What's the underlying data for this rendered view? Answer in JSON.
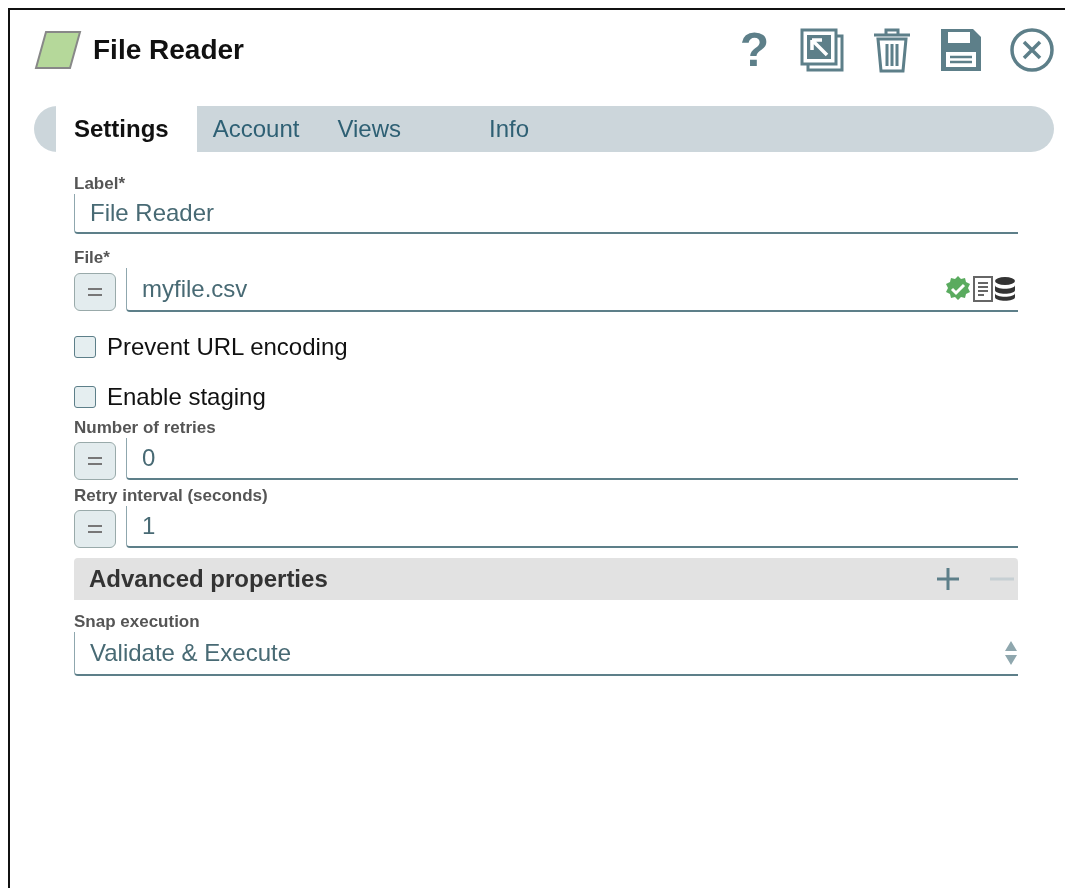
{
  "window": {
    "title": "File Reader",
    "help": "?"
  },
  "tabs": [
    {
      "label": "Settings",
      "selected": true
    },
    {
      "label": "Account",
      "selected": false
    },
    {
      "label": "Views",
      "selected": false
    },
    {
      "label": "Info",
      "selected": false
    }
  ],
  "fields": [
    {
      "kind": "text",
      "label": "Label*",
      "value": "File Reader"
    },
    {
      "kind": "file",
      "label": "File*",
      "value": "myfile.csv"
    },
    {
      "kind": "checkbox",
      "label": "Prevent URL encoding",
      "checked": false
    },
    {
      "kind": "checkbox",
      "label": "Enable staging",
      "checked": false
    },
    {
      "kind": "expression",
      "label": "Number of retries",
      "value": "0"
    },
    {
      "kind": "expression",
      "label": "Retry interval (seconds)",
      "value": "1"
    },
    {
      "kind": "section",
      "label": "Advanced properties"
    },
    {
      "kind": "select",
      "label": "Snap execution",
      "value": "Validate & Execute"
    }
  ]
}
